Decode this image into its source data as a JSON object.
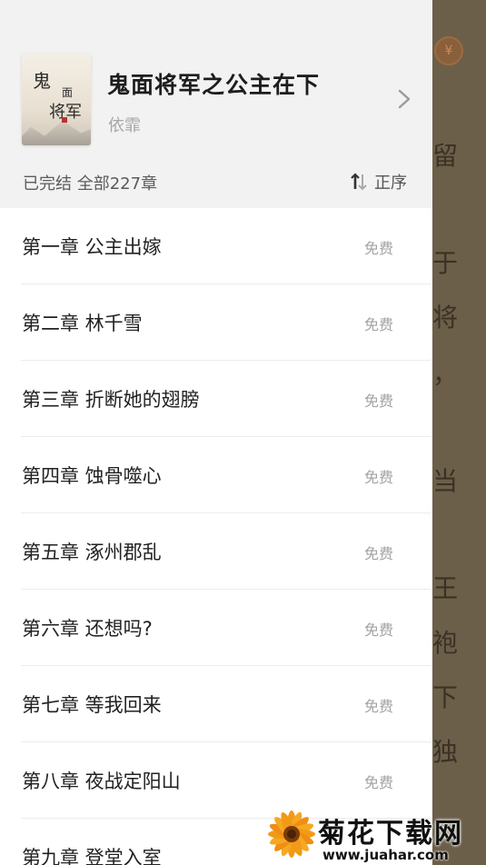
{
  "book": {
    "title": "鬼面将军之公主在下",
    "author": "依霏",
    "status_line": "已完结 全部227章",
    "sort_label": "正序",
    "cover_text": [
      "鬼",
      "面",
      "将军"
    ]
  },
  "chapters": [
    {
      "title": "第一章 公主出嫁",
      "badge": "免费"
    },
    {
      "title": "第二章 林千雪",
      "badge": "免费"
    },
    {
      "title": "第三章 折断她的翅膀",
      "badge": "免费"
    },
    {
      "title": "第四章 蚀骨噬心",
      "badge": "免费"
    },
    {
      "title": "第五章 涿州郡乱",
      "badge": "免费"
    },
    {
      "title": "第六章  还想吗?",
      "badge": "免费"
    },
    {
      "title": "第七章 等我回来",
      "badge": "免费"
    },
    {
      "title": "第八章 夜战定阳山",
      "badge": "免费"
    },
    {
      "title": "第九章 登堂入室",
      "badge": ""
    }
  ],
  "reader_bg": {
    "chars": [
      "留",
      "于",
      "将",
      "，",
      "当",
      "王",
      "袍",
      "下",
      "独"
    ],
    "coin_symbol": "¥"
  },
  "watermark": {
    "title": "菊花下载网",
    "url": "www.juahar.com"
  },
  "colors": {
    "drawer_header_bg": "#f2f2f2",
    "overlay_bg": "#6f624c",
    "badge_text": "#a3a3a3"
  }
}
